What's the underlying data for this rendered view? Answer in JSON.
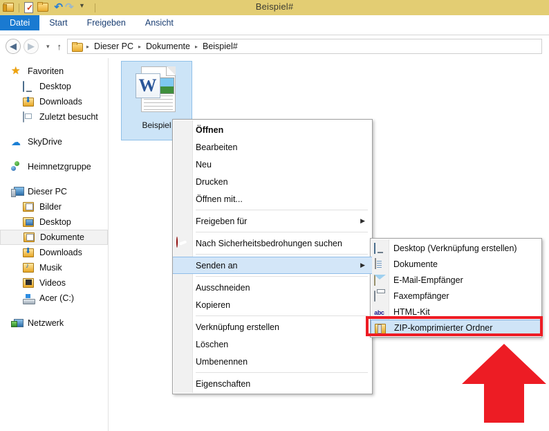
{
  "window": {
    "title": "Beispiel#",
    "titlebar_color": "#e3cd73",
    "quick_access": [
      {
        "name": "folder-icon",
        "label": "Explorer"
      },
      {
        "name": "properties-icon",
        "label": "Eigenschaften"
      },
      {
        "name": "new-folder-icon",
        "label": "Neuer Ordner"
      },
      {
        "name": "undo-icon",
        "label": "Rückgängig"
      },
      {
        "name": "redo-icon",
        "label": "Wiederholen"
      },
      {
        "name": "customize-icon",
        "label": "Anpassen"
      }
    ]
  },
  "ribbon": {
    "tabs": [
      {
        "label": "Datei",
        "active": true
      },
      {
        "label": "Start",
        "active": false
      },
      {
        "label": "Freigeben",
        "active": false
      },
      {
        "label": "Ansicht",
        "active": false
      }
    ],
    "active_color": "#1a7ad1"
  },
  "addressbar": {
    "back": "◀",
    "forward": "▶",
    "history": "▾",
    "up": "↑",
    "crumbs": [
      "Dieser PC",
      "Dokumente",
      "Beispiel#"
    ],
    "separator": "▸"
  },
  "sidebar": {
    "groups": [
      {
        "items": [
          {
            "label": "Favoriten",
            "icon": "star-icon",
            "level": 0,
            "selected": false
          },
          {
            "label": "Desktop",
            "icon": "monitor-icon",
            "level": 1,
            "selected": false
          },
          {
            "label": "Downloads",
            "icon": "downloads-folder-icon",
            "level": 1,
            "selected": false
          },
          {
            "label": "Zuletzt besucht",
            "icon": "recent-places-icon",
            "level": 1,
            "selected": false
          }
        ]
      },
      {
        "items": [
          {
            "label": "SkyDrive",
            "icon": "cloud-icon",
            "level": 0,
            "selected": false
          }
        ]
      },
      {
        "items": [
          {
            "label": "Heimnetzgruppe",
            "icon": "homegroup-icon",
            "level": 0,
            "selected": false
          }
        ]
      },
      {
        "items": [
          {
            "label": "Dieser PC",
            "icon": "computer-icon",
            "level": 0,
            "selected": false
          },
          {
            "label": "Bilder",
            "icon": "pictures-folder-icon",
            "level": 1,
            "selected": false
          },
          {
            "label": "Desktop",
            "icon": "desktop-folder-icon",
            "level": 1,
            "selected": false
          },
          {
            "label": "Dokumente",
            "icon": "documents-folder-icon",
            "level": 1,
            "selected": true
          },
          {
            "label": "Downloads",
            "icon": "downloads-folder-icon",
            "level": 1,
            "selected": false
          },
          {
            "label": "Musik",
            "icon": "music-folder-icon",
            "level": 1,
            "selected": false
          },
          {
            "label": "Videos",
            "icon": "videos-folder-icon",
            "level": 1,
            "selected": false
          },
          {
            "label": "Acer (C:)",
            "icon": "drive-icon",
            "level": 1,
            "selected": false
          }
        ]
      },
      {
        "items": [
          {
            "label": "Netzwerk",
            "icon": "network-icon",
            "level": 0,
            "selected": false
          }
        ]
      }
    ]
  },
  "content": {
    "files": [
      {
        "label": "Beispiel",
        "icon": "word-document-icon",
        "badge": "W",
        "selected": true
      }
    ]
  },
  "context_menu": {
    "items": [
      {
        "label": "Öffnen",
        "bold": true,
        "type": "item"
      },
      {
        "label": "Bearbeiten",
        "bold": false,
        "type": "item"
      },
      {
        "label": "Neu",
        "bold": false,
        "type": "item"
      },
      {
        "label": "Drucken",
        "bold": false,
        "type": "item"
      },
      {
        "label": "Öffnen mit...",
        "bold": false,
        "type": "item"
      },
      {
        "type": "separator"
      },
      {
        "label": "Freigeben für",
        "bold": false,
        "type": "item",
        "submenu": true,
        "arrow": "▶"
      },
      {
        "type": "separator"
      },
      {
        "label": "Nach Sicherheitsbedrohungen suchen",
        "bold": false,
        "type": "item",
        "icon": "security-scan-icon"
      },
      {
        "type": "separator"
      },
      {
        "label": "Senden an",
        "bold": false,
        "type": "item",
        "submenu": true,
        "arrow": "▶",
        "hover": true
      },
      {
        "type": "separator"
      },
      {
        "label": "Ausschneiden",
        "bold": false,
        "type": "item"
      },
      {
        "label": "Kopieren",
        "bold": false,
        "type": "item"
      },
      {
        "type": "separator"
      },
      {
        "label": "Verknüpfung erstellen",
        "bold": false,
        "type": "item"
      },
      {
        "label": "Löschen",
        "bold": false,
        "type": "item"
      },
      {
        "label": "Umbenennen",
        "bold": false,
        "type": "item"
      },
      {
        "type": "separator"
      },
      {
        "label": "Eigenschaften",
        "bold": false,
        "type": "item"
      }
    ]
  },
  "submenu": {
    "items": [
      {
        "label": "Desktop (Verknüpfung erstellen)",
        "icon": "monitor-icon",
        "selected": false
      },
      {
        "label": "Dokumente",
        "icon": "document-icon",
        "selected": false
      },
      {
        "label": "E-Mail-Empfänger",
        "icon": "mail-icon",
        "selected": false
      },
      {
        "label": "Faxempfänger",
        "icon": "fax-icon",
        "selected": false
      },
      {
        "label": "HTML-Kit",
        "icon": "html-kit-icon",
        "selected": false
      },
      {
        "label": "ZIP-komprimierter Ordner",
        "icon": "zip-folder-icon",
        "selected": true
      }
    ],
    "html_kit_glyph": "abc"
  },
  "annotations": {
    "highlight_color": "#ed1c24",
    "highlight_target": "ZIP-komprimierter Ordner",
    "arrow_direction": "up"
  }
}
